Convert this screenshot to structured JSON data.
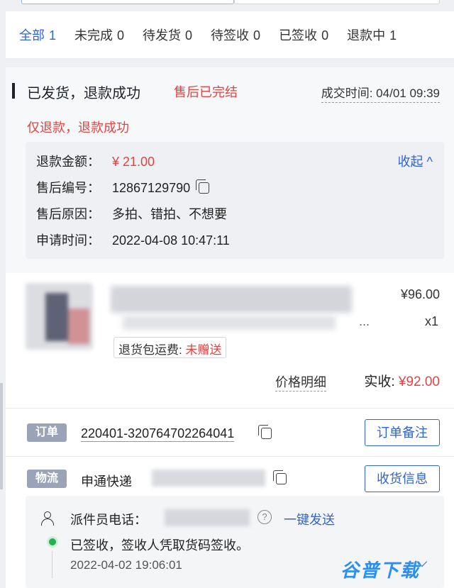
{
  "tabs": [
    {
      "label": "全部",
      "count": "1",
      "active": true
    },
    {
      "label": "未完成",
      "count": "0"
    },
    {
      "label": "待发货",
      "count": "0"
    },
    {
      "label": "待签收",
      "count": "0"
    },
    {
      "label": "已签收",
      "count": "0"
    },
    {
      "label": "退款中",
      "count": "1"
    }
  ],
  "order": {
    "status_title": "已发货，退款成功",
    "after_sale_status": "售后已完结",
    "deal_time": "成交时间: 04/01 09:39",
    "refund_type": "仅退款，退款成功",
    "collapse_label": "收起",
    "refund_details": {
      "amount_label": "退款金额：",
      "amount_value": "¥ 21.00",
      "id_label": "售后编号：",
      "id_value": "12867129790",
      "reason_label": "售后原因：",
      "reason_value": "多拍、错拍、不想要",
      "apply_time_label": "申请时间：",
      "apply_time_value": "2022-04-08 10:47:11"
    },
    "product": {
      "title_ellipsis": "...",
      "price": "¥96.00",
      "quantity": "x1",
      "freight_label": "退货包运费:",
      "freight_value": "未赠送",
      "price_detail_label": "价格明细",
      "received_label": "实收:",
      "received_value": "¥92.00"
    },
    "order_tag": "订单",
    "order_number": "220401-320764702264041",
    "note_button": "订单备注",
    "logistics_tag": "物流",
    "carrier": "申通快递",
    "receiver_button": "收货信息",
    "courier_phone_label": "派件员电话：",
    "help_symbol": "?",
    "one_click_send": "一键发送",
    "track_status": "已签收，签收人凭取货码签收。",
    "track_time": "2022-04-02 19:06:01"
  },
  "watermark": "谷普下载",
  "colors": {
    "accent": "#2f64d6",
    "danger": "#e64340",
    "tag_bg": "#9aa3b7",
    "success": "#23b14d"
  }
}
